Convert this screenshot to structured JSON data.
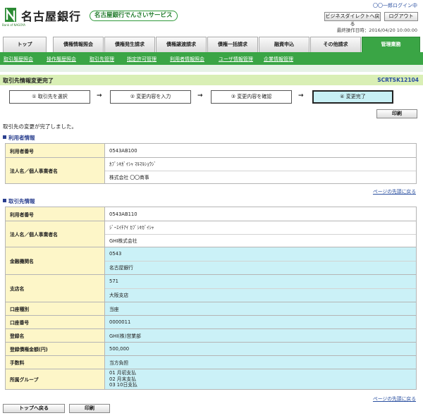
{
  "header": {
    "logo_text": "名古屋銀行",
    "logo_sub": "Bank of NAGOYA",
    "service_name": "名古屋銀行でんさいサービス",
    "user_login": "〇〇一郎ログイン中",
    "business_direct_label": "ビジネスダイレクトへ戻る",
    "logout_label": "ログアウト",
    "last_operation": "最終操作日時：2016/04/20 10:00:00"
  },
  "tabs": [
    {
      "label": "トップ"
    },
    {
      "label": "債権情報照会"
    },
    {
      "label": "債権発生請求"
    },
    {
      "label": "債権譲渡請求"
    },
    {
      "label": "債権一括請求"
    },
    {
      "label": "融資申込"
    },
    {
      "label": "その他請求"
    },
    {
      "label": "管理業務"
    }
  ],
  "subnav": [
    {
      "label": "取引履歴照会"
    },
    {
      "label": "操作履歴照会"
    },
    {
      "label": "取引先管理"
    },
    {
      "label": "指定許可管理"
    },
    {
      "label": "利用者情報照会"
    },
    {
      "label": "ユーザ情報管理"
    },
    {
      "label": "企業情報管理"
    }
  ],
  "page": {
    "title": "取引先情報変更完了",
    "screen_id": "SCRTSK12104",
    "message": "取引先の変更が完了しました。",
    "print_label": "印刷",
    "page_top_link": "ページの先頭に戻る"
  },
  "steps": [
    {
      "label": "① 取引先を選択"
    },
    {
      "label": "② 変更内容を入力"
    },
    {
      "label": "③ 変更内容を確認"
    },
    {
      "label": "④ 変更完了"
    }
  ],
  "arrow": "→",
  "user_section": {
    "heading": "利用者情報",
    "user_no_label": "利用者番号",
    "user_no": "0543AB100",
    "name_label": "法人名／個人事業者名",
    "name_kana": "ｶﾌﾞｼｷｶﾞｲｼｬ ﾏﾙﾏﾙｼｮｳｼﾞ",
    "name": "株式会社 〇〇商事"
  },
  "partner_section": {
    "heading": "取引先情報",
    "user_no_label": "利用者番号",
    "user_no": "0543AB110",
    "name_label": "法人名／個人事業者名",
    "name_kana": "ｼﾞｰｴｲﾁｱｲ ｶﾌﾞｼｷｶﾞｲｼｬ",
    "name": "GHI株式会社",
    "bank_label": "金融機関名",
    "bank_code": "0543",
    "bank_name": "名古屋銀行",
    "branch_label": "支店名",
    "branch_code": "571",
    "branch_name": "大阪支店",
    "account_type_label": "口座種別",
    "account_type": "当座",
    "account_no_label": "口座番号",
    "account_no": "0000011",
    "reg_name_label": "登録名",
    "reg_name": "GHI(株)営業部",
    "amount_label": "登録債権金額(円)",
    "amount": "500,000",
    "fee_label": "手数料",
    "fee": "当方負担",
    "group_label": "所属グループ",
    "groups": [
      "01 月初支払",
      "02 月末支払",
      "03 10日支払"
    ]
  },
  "footer": {
    "top_button": "トップへ戻る",
    "print_button": "印刷"
  },
  "colors": {
    "brand_green": "#3aa545",
    "title_bar": "#d9efb5",
    "label_cell": "#fdf6c8",
    "changed_cell": "#cbf1f7",
    "link_blue": "#2a4fa0"
  }
}
